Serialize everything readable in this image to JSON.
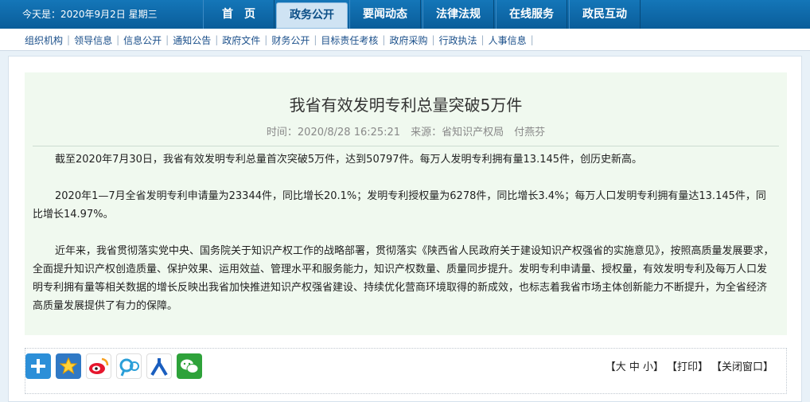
{
  "header": {
    "date_text": "今天是：2020年9月2日 星期三",
    "nav": [
      {
        "label": "首　页",
        "active": false
      },
      {
        "label": "政务公开",
        "active": true
      },
      {
        "label": "要闻动态",
        "active": false
      },
      {
        "label": "法律法规",
        "active": false
      },
      {
        "label": "在线服务",
        "active": false
      },
      {
        "label": "政民互动",
        "active": false
      }
    ]
  },
  "subnav": [
    "组织机构",
    "领导信息",
    "信息公开",
    "通知公告",
    "政府文件",
    "财务公开",
    "目标责任考核",
    "政府采购",
    "行政执法",
    "人事信息"
  ],
  "article": {
    "title": "我省有效发明专利总量突破5万件",
    "meta": "时间：2020/8/28 16:25:21　来源：省知识产权局　付燕芬",
    "paragraphs": [
      "截至2020年7月30日，我省有效发明专利总量首次突破5万件，达到50797件。每万人发明专利拥有量13.145件，创历史新高。",
      "2020年1—7月全省发明专利申请量为23344件，同比增长20.1%；发明专利授权量为6278件，同比增长3.4%；每万人口发明专利拥有量达13.145件，同比增长14.97%。",
      "近年来，我省贯彻落实党中央、国务院关于知识产权工作的战略部署，贯彻落实《陕西省人民政府关于建设知识产权强省的实施意见》，按照高质量发展要求，全面提升知识产权创造质量、保护效果、运用效益、管理水平和服务能力，知识产权数量、质量同步提升。发明专利申请量、授权量，有效发明专利及每万人口发明专利拥有量等相关数据的增长反映出我省加快推进知识产权强省建设、持续优化营商环境取得的新成效，也标志着我省市场主体创新能力不断提升，为全省经济高质量发展提供了有力的保障。"
    ]
  },
  "share": {
    "icons": [
      "plus-icon",
      "favorite-icon",
      "weibo-icon",
      "tencent-weibo-icon",
      "renren-icon",
      "wechat-icon"
    ]
  },
  "tools": {
    "font_size": "【大 中 小】",
    "print": "【打印】",
    "close": "【关闭窗口】"
  }
}
